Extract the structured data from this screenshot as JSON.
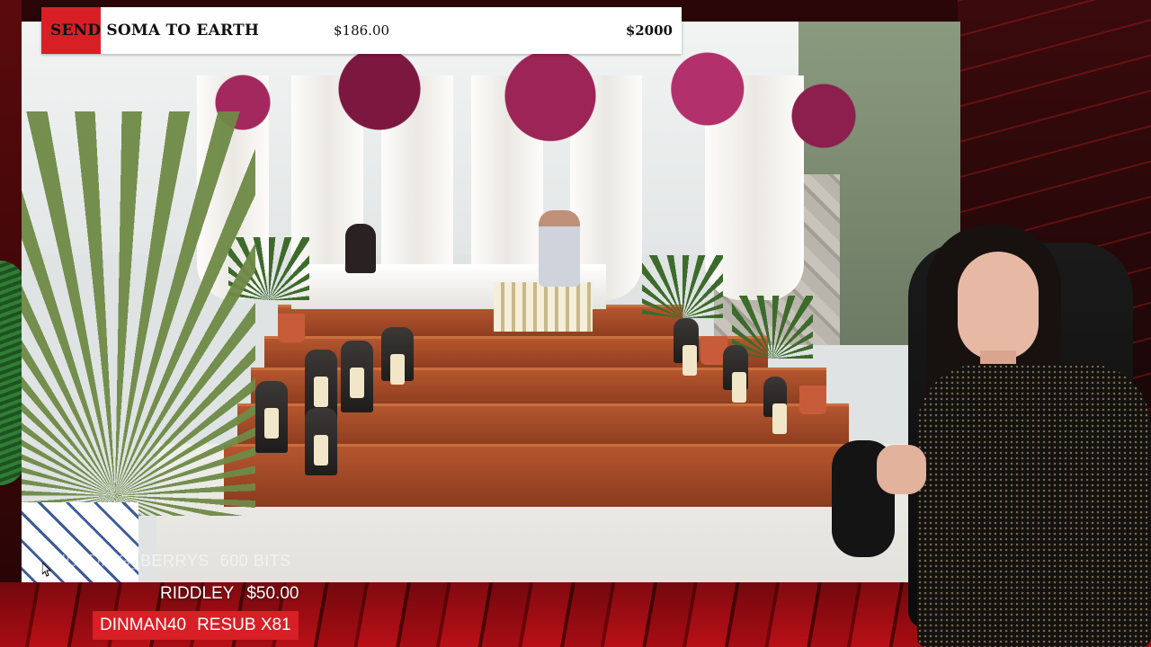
{
  "goal": {
    "title": "SEND SOMA TO EARTH",
    "current": "$186.00",
    "target": "$2000",
    "progress": 0.093,
    "fill_color": "#d81f26"
  },
  "alerts": {
    "faded_row": [
      "HOLDING_BERRYS",
      "600 BITS"
    ],
    "tip_row": [
      "RIDDLEY",
      "$50.00"
    ],
    "sub_badge": [
      "DINMAN40",
      "RESUB X81"
    ],
    "badge_color": "#d81f26"
  },
  "icons": {
    "cursor": "arrow-cursor-icon"
  }
}
